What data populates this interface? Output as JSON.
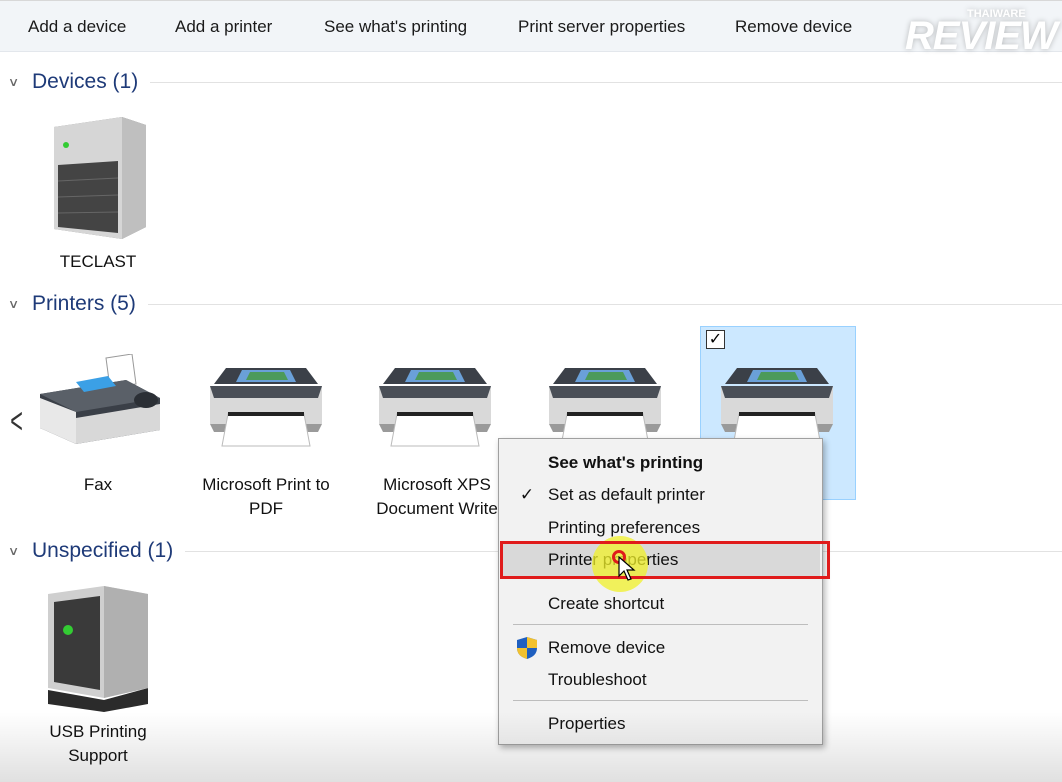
{
  "toolbar": {
    "add_device": "Add a device",
    "add_printer": "Add a printer",
    "see_printing": "See what's printing",
    "print_server": "Print server properties",
    "remove_device": "Remove device"
  },
  "watermark": {
    "top": "THAIWARE",
    "main": "REVIEW"
  },
  "sections": {
    "devices": "Devices (1)",
    "printers": "Printers (5)",
    "unspecified": "Unspecified (1)"
  },
  "devices": [
    {
      "name": "TECLAST"
    }
  ],
  "printers": [
    {
      "line1": "Fax",
      "line2": ""
    },
    {
      "line1": "Microsoft Print to",
      "line2": "PDF"
    },
    {
      "line1": "Microsoft XPS",
      "line2": "Document Write"
    }
  ],
  "unspecified": [
    {
      "line1": "USB Printing",
      "line2": "Support"
    }
  ],
  "context_menu": {
    "items": [
      {
        "label": "See what's printing",
        "icon": ""
      },
      {
        "label": "Set as default printer",
        "icon": "checkmark-icon"
      },
      {
        "label": "Printing preferences",
        "icon": ""
      },
      {
        "label": "Printer properties",
        "icon": ""
      },
      {
        "label": "Create shortcut",
        "icon": ""
      },
      {
        "label": "Remove device",
        "icon": "uac-shield-icon"
      },
      {
        "label": "Troubleshoot",
        "icon": ""
      },
      {
        "label": "Properties",
        "icon": ""
      }
    ],
    "highlighted": "Printer properties"
  },
  "colors": {
    "section_title": "#1e3a78",
    "selection": "#cce8ff",
    "annotation": "#e01b1b"
  }
}
